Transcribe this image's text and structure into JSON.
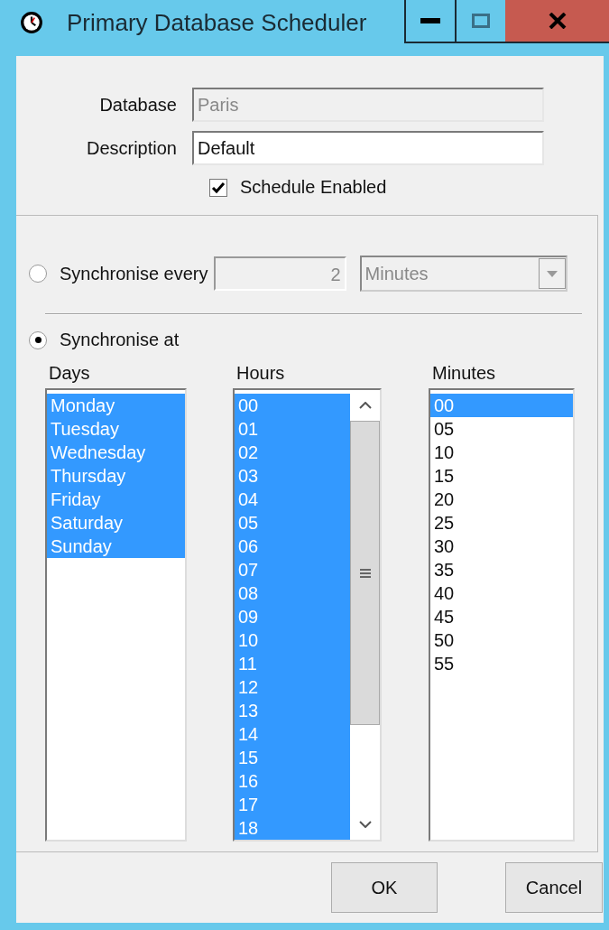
{
  "window": {
    "title": "Primary Database Scheduler"
  },
  "fields": [
    {
      "label": "Database",
      "value": "Paris",
      "disabled": true
    },
    {
      "label": "Description",
      "value": "Default",
      "disabled": false
    }
  ],
  "schedule_enabled": {
    "label": "Schedule Enabled",
    "checked": true
  },
  "sync_every": {
    "label": "Synchronise every",
    "selected": false,
    "interval": "2",
    "unit": "Minutes",
    "disabled": true
  },
  "sync_at": {
    "label": "Synchronise at",
    "selected": true
  },
  "lists": [
    {
      "heading": "Days",
      "scrollbar": false,
      "items": [
        {
          "label": "Monday",
          "selected": true
        },
        {
          "label": "Tuesday",
          "selected": true
        },
        {
          "label": "Wednesday",
          "selected": true
        },
        {
          "label": "Thursday",
          "selected": true
        },
        {
          "label": "Friday",
          "selected": true
        },
        {
          "label": "Saturday",
          "selected": true
        },
        {
          "label": "Sunday",
          "selected": true
        }
      ]
    },
    {
      "heading": "Hours",
      "scrollbar": true,
      "items": [
        {
          "label": "00",
          "selected": true
        },
        {
          "label": "01",
          "selected": true
        },
        {
          "label": "02",
          "selected": true
        },
        {
          "label": "03",
          "selected": true
        },
        {
          "label": "04",
          "selected": true
        },
        {
          "label": "05",
          "selected": true
        },
        {
          "label": "06",
          "selected": true
        },
        {
          "label": "07",
          "selected": true
        },
        {
          "label": "08",
          "selected": true
        },
        {
          "label": "09",
          "selected": true
        },
        {
          "label": "10",
          "selected": true
        },
        {
          "label": "11",
          "selected": true
        },
        {
          "label": "12",
          "selected": true
        },
        {
          "label": "13",
          "selected": true
        },
        {
          "label": "14",
          "selected": true
        },
        {
          "label": "15",
          "selected": true
        },
        {
          "label": "16",
          "selected": true
        },
        {
          "label": "17",
          "selected": true
        },
        {
          "label": "18",
          "selected": true
        }
      ]
    },
    {
      "heading": "Minutes",
      "scrollbar": false,
      "items": [
        {
          "label": "00",
          "selected": true
        },
        {
          "label": "05",
          "selected": false
        },
        {
          "label": "10",
          "selected": false
        },
        {
          "label": "15",
          "selected": false
        },
        {
          "label": "20",
          "selected": false
        },
        {
          "label": "25",
          "selected": false
        },
        {
          "label": "30",
          "selected": false
        },
        {
          "label": "35",
          "selected": false
        },
        {
          "label": "40",
          "selected": false
        },
        {
          "label": "45",
          "selected": false
        },
        {
          "label": "50",
          "selected": false
        },
        {
          "label": "55",
          "selected": false
        }
      ]
    }
  ],
  "buttons": [
    "OK",
    "Cancel"
  ]
}
